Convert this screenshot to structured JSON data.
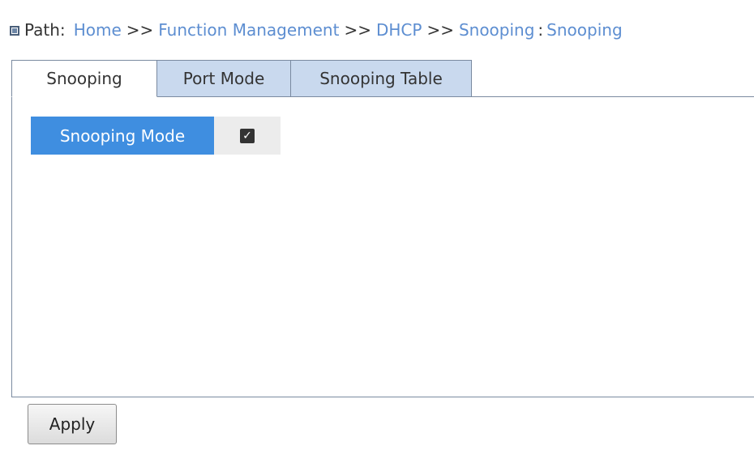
{
  "breadcrumb": {
    "icon": "square-bullet-icon",
    "label": "Path:",
    "items": [
      "Home",
      "Function Management",
      "DHCP",
      "Snooping"
    ],
    "separator": ">>",
    "current": "Snooping",
    "link_color": "#5d8ed1"
  },
  "tabs": [
    {
      "label": "Snooping",
      "active": true
    },
    {
      "label": "Port Mode",
      "active": false
    },
    {
      "label": "Snooping Table",
      "active": false
    }
  ],
  "form": {
    "snooping_mode_label": "Snooping Mode",
    "snooping_mode_checked": true,
    "checkbox_glyph": "✓",
    "label_bg_color": "#3f8ee0"
  },
  "actions": {
    "apply_label": "Apply"
  }
}
